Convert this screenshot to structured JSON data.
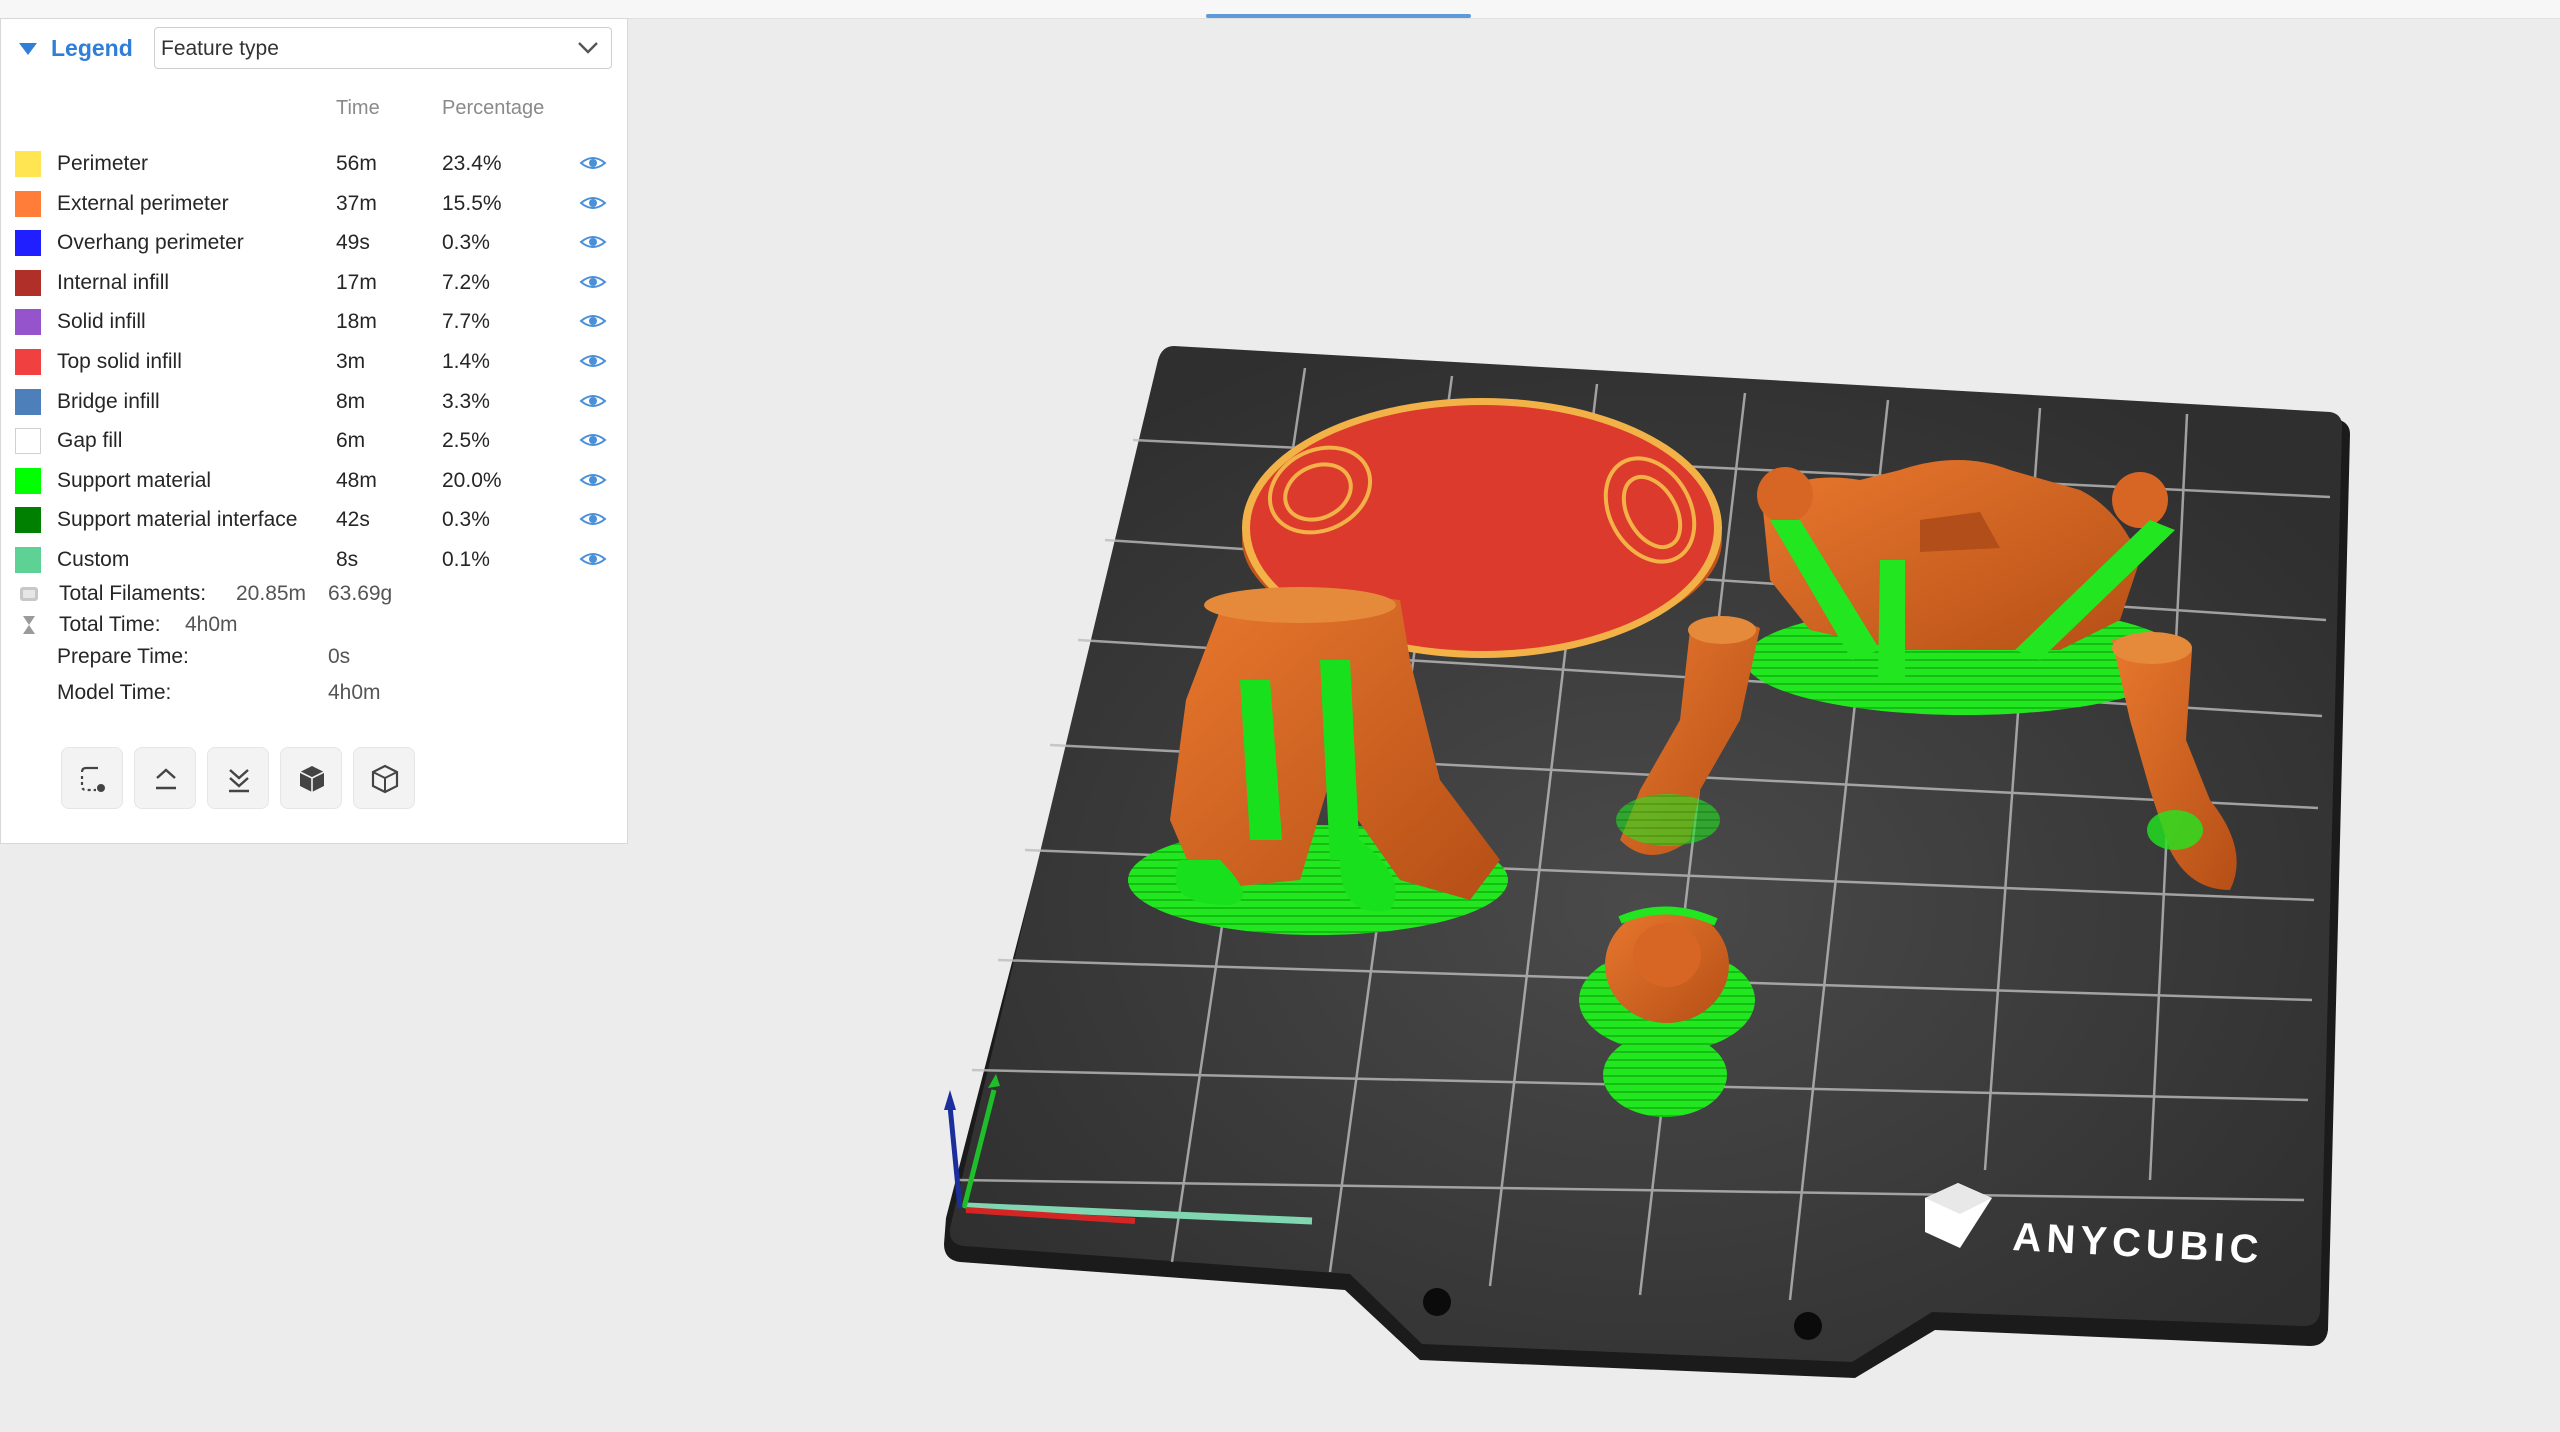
{
  "legend": {
    "title": "Legend",
    "view_type": "Feature type",
    "columns": {
      "time": "Time",
      "percentage": "Percentage"
    },
    "features": [
      {
        "label": "Perimeter",
        "time": "56m",
        "percentage": "23.4%",
        "color": "#ffe552"
      },
      {
        "label": "External perimeter",
        "time": "37m",
        "percentage": "15.5%",
        "color": "#ff7d38"
      },
      {
        "label": "Overhang perimeter",
        "time": "49s",
        "percentage": "0.3%",
        "color": "#1f1fff"
      },
      {
        "label": "Internal infill",
        "time": "17m",
        "percentage": "7.2%",
        "color": "#b03029"
      },
      {
        "label": "Solid infill",
        "time": "18m",
        "percentage": "7.7%",
        "color": "#9654cc"
      },
      {
        "label": "Top solid infill",
        "time": "3m",
        "percentage": "1.4%",
        "color": "#f04040"
      },
      {
        "label": "Bridge infill",
        "time": "8m",
        "percentage": "3.3%",
        "color": "#4d80ba"
      },
      {
        "label": "Gap fill",
        "time": "6m",
        "percentage": "2.5%",
        "color": "#ffffff"
      },
      {
        "label": "Support material",
        "time": "48m",
        "percentage": "20.0%",
        "color": "#00ff00"
      },
      {
        "label": "Support material interface",
        "time": "42s",
        "percentage": "0.3%",
        "color": "#008000"
      },
      {
        "label": "Custom",
        "time": "8s",
        "percentage": "0.1%",
        "color": "#5ed194"
      }
    ],
    "summary": {
      "total_filaments_label": "Total Filaments:",
      "total_filaments_length": "20.85m",
      "total_filaments_weight": "63.69g",
      "total_time_label": "Total Time:",
      "total_time": "4h0m",
      "prepare_time_label": "Prepare Time:",
      "prepare_time": "0s",
      "model_time_label": "Model Time:",
      "model_time": "4h0m"
    },
    "tools": [
      "travel-moves-icon",
      "layer-up-icon",
      "layer-down-icon",
      "solid-view-icon",
      "wireframe-view-icon"
    ]
  },
  "bed": {
    "brand": "ANYCUBIC"
  },
  "colors": {
    "accent": "#2f7ed8",
    "support": "#00ff00",
    "external_perimeter": "#d9621f",
    "top_solid": "#e0362b"
  }
}
